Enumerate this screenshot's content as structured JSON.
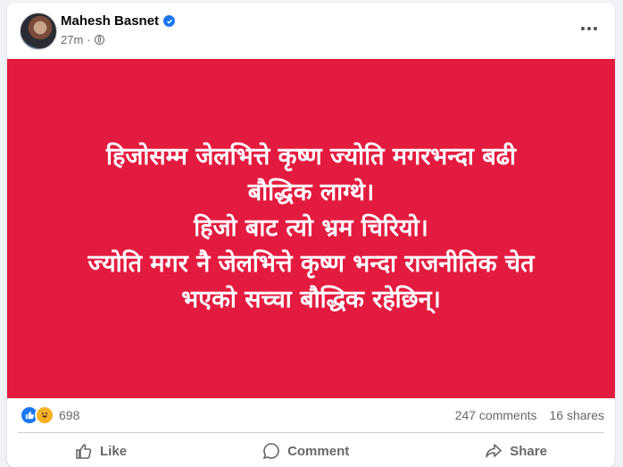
{
  "post": {
    "author": "Mahesh Basnet",
    "time": "27m",
    "lines": [
      "हिजोसम्म जेलभित्ते कृष्ण ज्योति मगरभन्दा बढी",
      "बौद्धिक लाग्थे।",
      "हिजो बाट त्यो भ्रम चिरियो।",
      "ज्योति मगर नै जेलभित्ते कृष्ण भन्दा राजनीतिक चेत",
      "भएको सच्चा बौद्धिक रहेछिन्।"
    ],
    "background_color": "#e41b40"
  },
  "stats": {
    "reactions": "698",
    "comments": "247 comments",
    "shares": "16 shares"
  },
  "actions": {
    "like": "Like",
    "comment": "Comment",
    "share": "Share"
  },
  "icons": [
    "verified-icon",
    "globe-icon",
    "more-icon",
    "like-reaction-icon",
    "haha-reaction-icon",
    "like-icon",
    "comment-icon",
    "share-icon"
  ]
}
